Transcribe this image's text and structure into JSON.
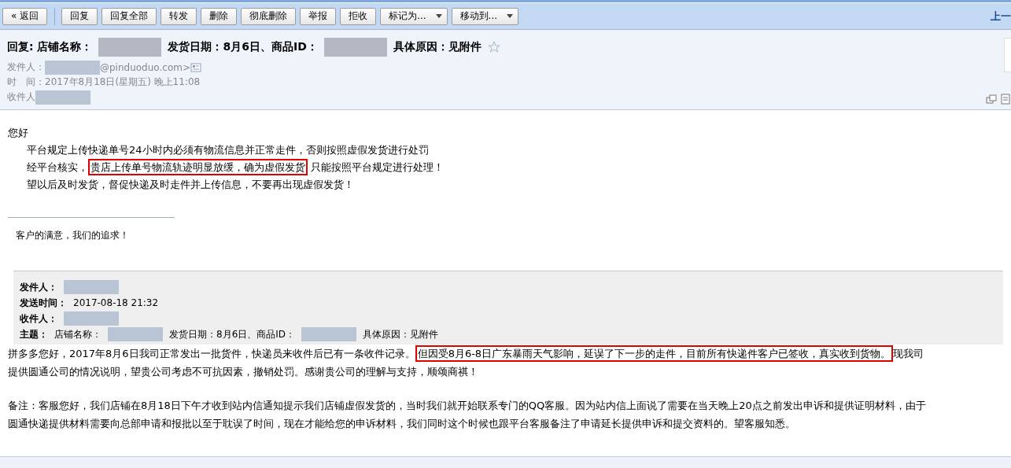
{
  "toolbar": {
    "back": "« 返回",
    "buttons": [
      {
        "label": "回复",
        "kind": "button"
      },
      {
        "label": "回复全部",
        "kind": "button"
      },
      {
        "label": "转发",
        "kind": "button"
      },
      {
        "label": "删除",
        "kind": "button"
      },
      {
        "label": "彻底删除",
        "kind": "button"
      },
      {
        "label": "举报",
        "kind": "button"
      },
      {
        "label": "拒收",
        "kind": "button"
      },
      {
        "label": "标记为...",
        "kind": "dropdown"
      },
      {
        "label": "移动到...",
        "kind": "dropdown"
      }
    ],
    "nav_link": "上一"
  },
  "header": {
    "subject": [
      {
        "kind": "text",
        "text": "回复: 店铺名称："
      },
      {
        "kind": "redacted"
      },
      {
        "kind": "text",
        "text": "发货日期：8月6日、商品ID："
      },
      {
        "kind": "redacted"
      },
      {
        "kind": "text",
        "text": "具体原因：见附件"
      }
    ],
    "starred": false,
    "fields": [
      {
        "label": "发件人：",
        "parts": [
          {
            "kind": "redacted"
          },
          {
            "kind": "text",
            "text": "@pinduoduo.com>"
          },
          {
            "kind": "card"
          }
        ]
      },
      {
        "label": "时　间：",
        "parts": [
          {
            "kind": "text",
            "text": "2017年8月18日(星期五) 晚上11:08"
          }
        ]
      },
      {
        "label": "收件人",
        "parts": [
          {
            "kind": "redacted"
          }
        ]
      }
    ]
  },
  "body": {
    "greeting": "您好",
    "lines": [
      [
        {
          "text": "平台规定上传快递单号24小时内必须有物流信息并正常走件，否则按照虚假发货进行处罚",
          "boxed": false
        }
      ],
      [
        {
          "text": "经平台核实，",
          "boxed": false
        },
        {
          "text": "贵店上传单号物流轨迹明显放缓，确为虚假发货",
          "boxed": true
        },
        {
          "text": " 只能按照平台规定进行处理！",
          "boxed": false
        }
      ],
      [
        {
          "text": "望以后及时发货，督促快递及时走件并上传信息，不要再出现虚假发货！",
          "boxed": false
        }
      ]
    ],
    "signature": "客户的满意，我们的追求！"
  },
  "quoted": {
    "fields": [
      {
        "label": "发件人：",
        "parts": [
          {
            "kind": "redacted"
          }
        ]
      },
      {
        "label": "发送时间：",
        "parts": [
          {
            "kind": "text",
            "text": "2017-08-18 21:32"
          }
        ]
      },
      {
        "label": "收件人：",
        "parts": [
          {
            "kind": "redacted"
          }
        ]
      },
      {
        "label": "主题：",
        "parts": [
          {
            "kind": "text",
            "text": "店铺名称："
          },
          {
            "kind": "redacted"
          },
          {
            "kind": "text",
            "text": "发货日期：8月6日、商品ID："
          },
          {
            "kind": "redacted"
          },
          {
            "kind": "text",
            "text": "具体原因：见附件"
          }
        ]
      }
    ],
    "paragraphs": [
      [
        [
          {
            "text": "拼多多您好，2017年8月6日我司正常发出一批货件，快递员来收件后已有一条收件记录。",
            "boxed": false
          },
          {
            "text": "但因受8月6-8日广东暴雨天气影响，延误了下一步的走件，目前所有快递件客户已签收，真实收到货物。",
            "boxed": true
          },
          {
            "text": "现我司",
            "boxed": false
          }
        ],
        [
          {
            "text": "提供圆通公司的情况说明，望贵公司考虑不可抗因素，撤销处罚。感谢贵公司的理解与支持，顺颂商祺！",
            "boxed": false
          }
        ]
      ],
      [
        [
          {
            "text": "备注：客服您好，我们店铺在8月18日下午才收到站内信通知提示我们店铺虚假发货的，当时我们就开始联系专门的QQ客服。因为站内信上面说了需要在当天晚上20点之前发出申诉和提供证明材料，由于",
            "boxed": false
          }
        ],
        [
          {
            "text": "圆通快递提供材料需要向总部申请和报批以至于耽误了时间，现在才能给您的申诉材料，我们同时这个时候也跟平台客服备注了申请延长提供申诉和提交资料的。望客服知悉。",
            "boxed": false
          }
        ]
      ]
    ]
  }
}
